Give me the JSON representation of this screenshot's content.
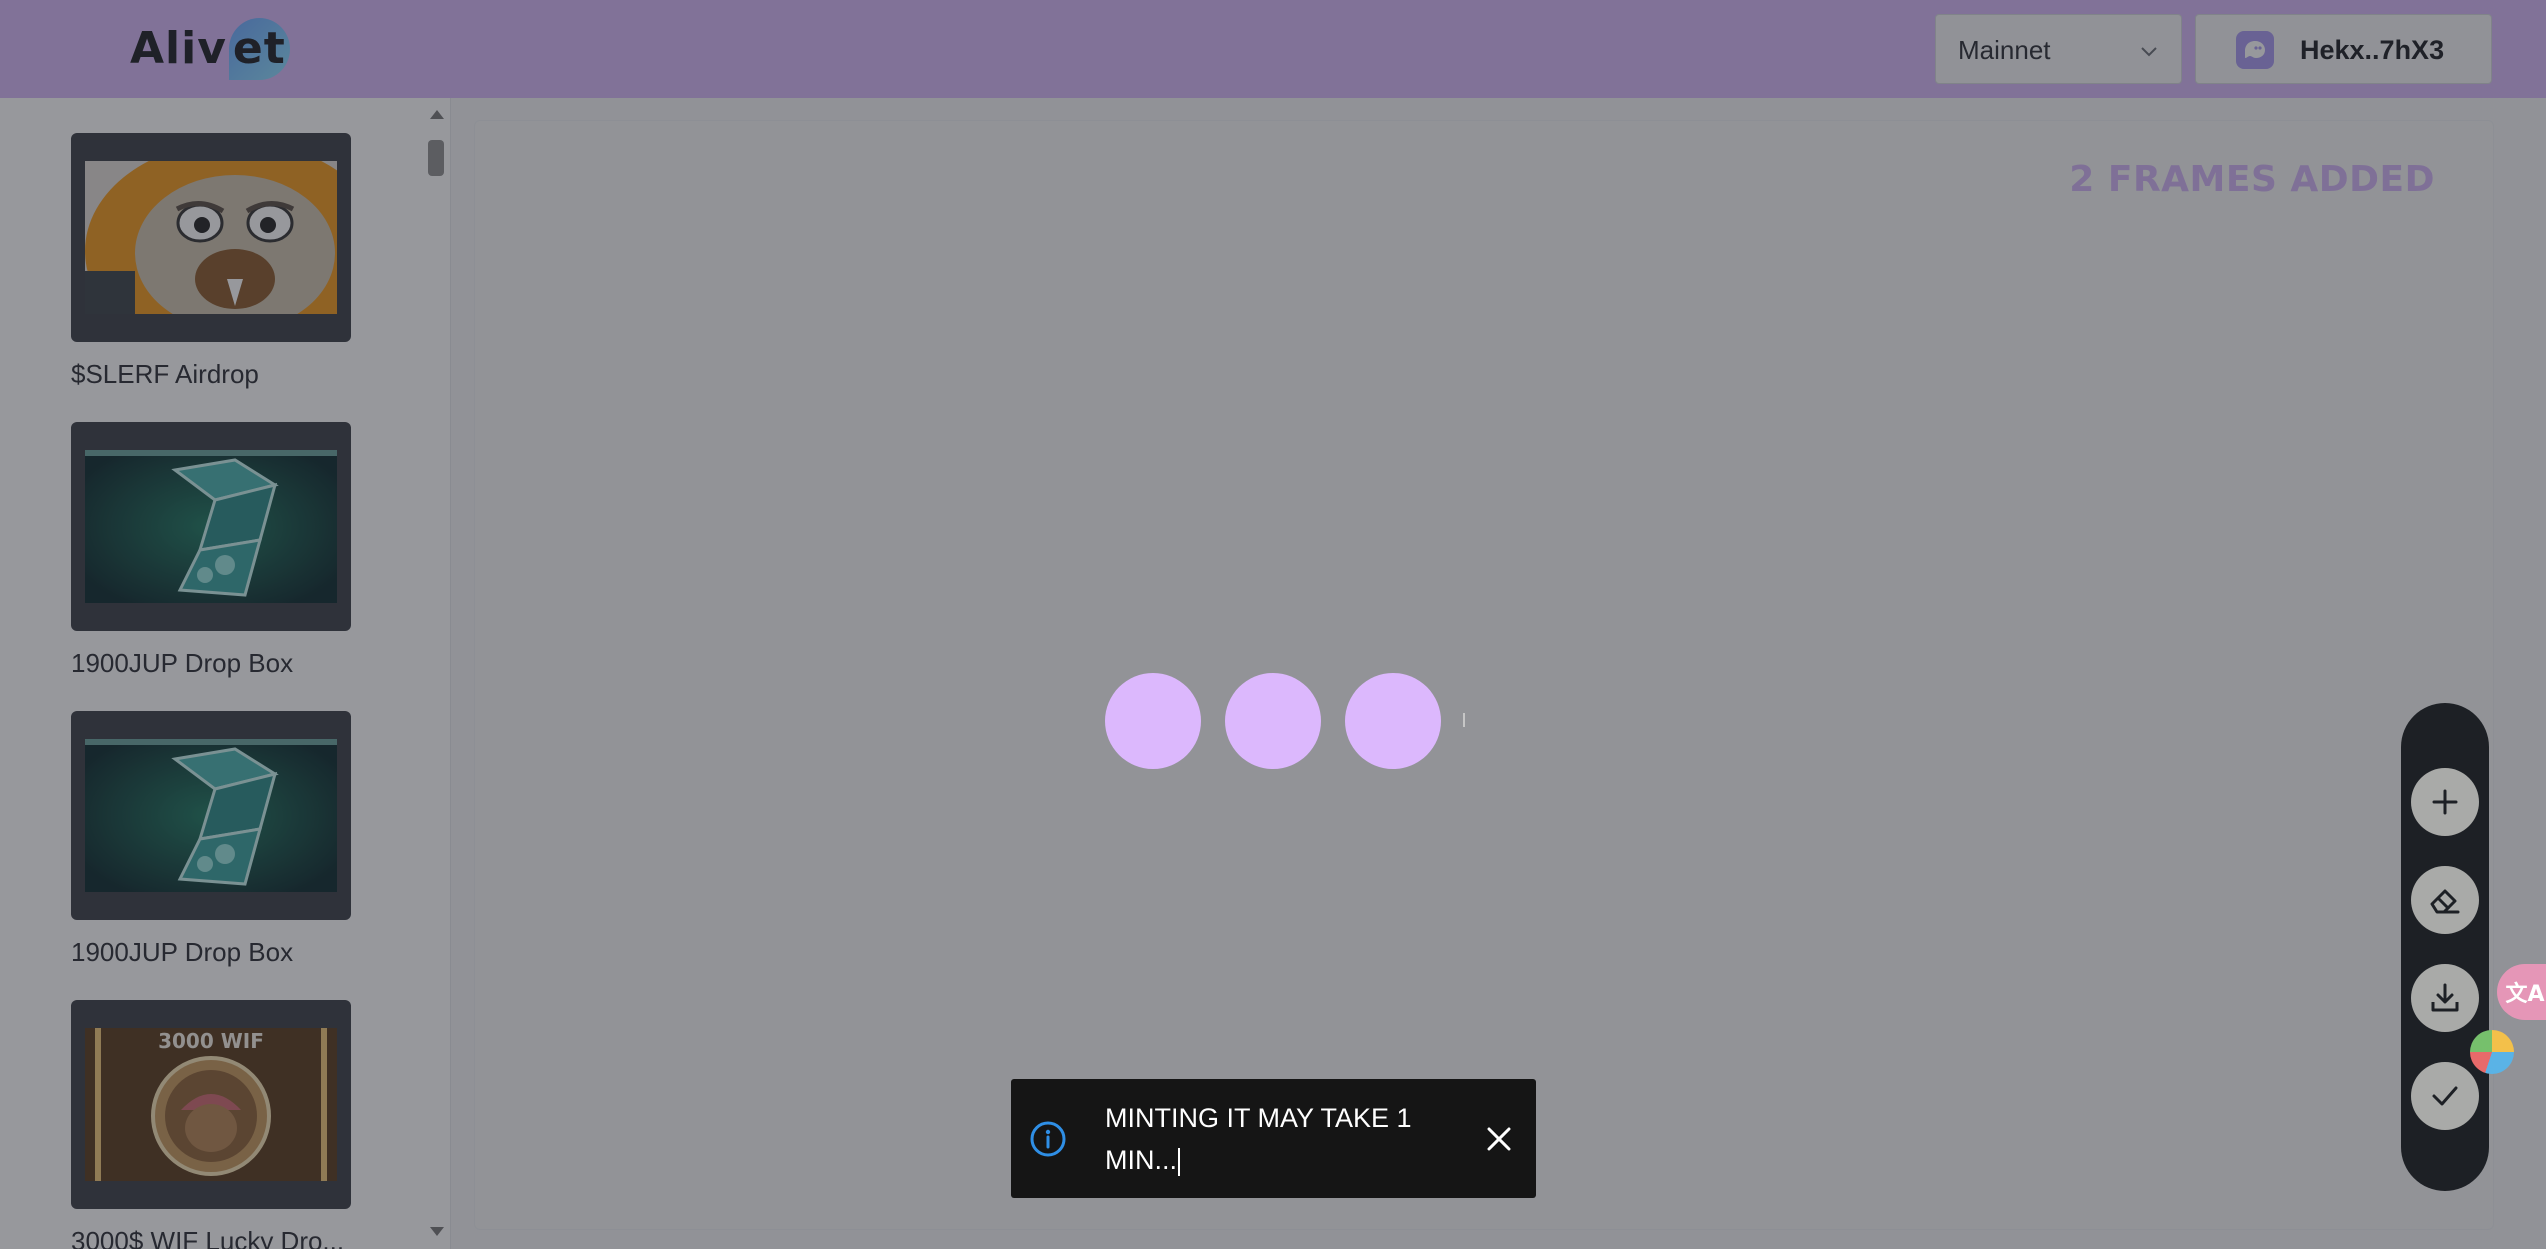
{
  "header": {
    "logo_text": "Aliv",
    "logo_tail": "et",
    "network": {
      "selected": "Mainnet"
    },
    "wallet": {
      "label": "Hekx..7hX3"
    }
  },
  "sidebar": {
    "items": [
      {
        "label": "$SLERF Airdrop",
        "thumb": "slerf-sloth"
      },
      {
        "label": "1900JUP Drop Box",
        "thumb": "jup-drop-box"
      },
      {
        "label": "1900JUP Drop Box",
        "thumb": "jup-drop-box"
      },
      {
        "label": "3000$ WIF Lucky Dro...",
        "thumb": "wif-coin",
        "thumb_text": "3000 WIF"
      }
    ]
  },
  "canvas": {
    "frames_added": "2 FRAMES ADDED"
  },
  "toolbar": {
    "buttons": [
      "add-icon",
      "eraser-icon",
      "download-icon",
      "check-icon"
    ]
  },
  "toast": {
    "message": "MINTING IT MAY TAKE 1 MIN..."
  },
  "colors": {
    "header_bg": "#d6b7f7",
    "accent_purple": "#dcb8fd",
    "toolbar_bg": "#1d2025",
    "toast_bg": "#151515",
    "info_blue": "#2f8fe6"
  }
}
